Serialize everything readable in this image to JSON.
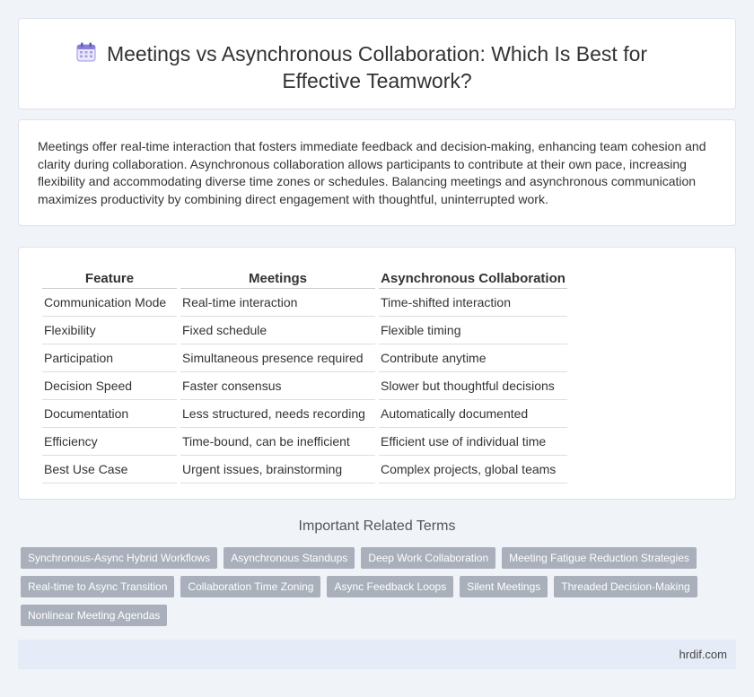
{
  "header": {
    "title": "Meetings vs Asynchronous Collaboration: Which Is Best for Effective Teamwork?",
    "icon": "calendar-icon"
  },
  "summary": "Meetings offer real-time interaction that fosters immediate feedback and decision-making, enhancing team cohesion and clarity during collaboration. Asynchronous collaboration allows participants to contribute at their own pace, increasing flexibility and accommodating diverse time zones or schedules. Balancing meetings and asynchronous communication maximizes productivity by combining direct engagement with thoughtful, uninterrupted work.",
  "table": {
    "headers": [
      "Feature",
      "Meetings",
      "Asynchronous Collaboration"
    ],
    "rows": [
      [
        "Communication Mode",
        "Real-time interaction",
        "Time-shifted interaction"
      ],
      [
        "Flexibility",
        "Fixed schedule",
        "Flexible timing"
      ],
      [
        "Participation",
        "Simultaneous presence required",
        "Contribute anytime"
      ],
      [
        "Decision Speed",
        "Faster consensus",
        "Slower but thoughtful decisions"
      ],
      [
        "Documentation",
        "Less structured, needs recording",
        "Automatically documented"
      ],
      [
        "Efficiency",
        "Time-bound, can be inefficient",
        "Efficient use of individual time"
      ],
      [
        "Best Use Case",
        "Urgent issues, brainstorming",
        "Complex projects, global teams"
      ]
    ]
  },
  "related": {
    "title": "Important Related Terms",
    "tags": [
      "Synchronous-Async Hybrid Workflows",
      "Asynchronous Standups",
      "Deep Work Collaboration",
      "Meeting Fatigue Reduction Strategies",
      "Real-time to Async Transition",
      "Collaboration Time Zoning",
      "Async Feedback Loops",
      "Silent Meetings",
      "Threaded Decision-Making",
      "Nonlinear Meeting Agendas"
    ]
  },
  "footer": {
    "site": "hrdif.com"
  },
  "colors": {
    "background": "#f0f3f8",
    "tag": "#a9b0bb",
    "footer": "#e6ecf7",
    "icon": "#8a7fd8"
  }
}
